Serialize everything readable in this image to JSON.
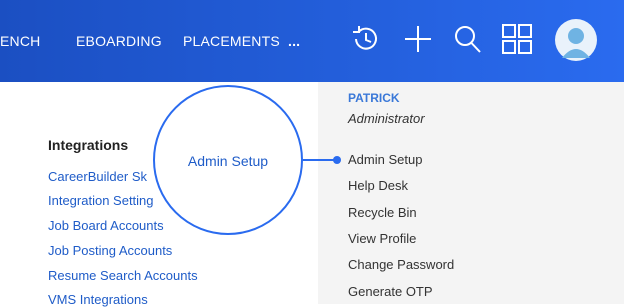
{
  "nav": {
    "items": [
      "ENCH",
      "EBOARDING",
      "PLACEMENTS",
      "..."
    ]
  },
  "icons": {
    "history": "history-icon",
    "add": "plus-icon",
    "search": "search-icon",
    "apps": "grid-icon",
    "avatar": "avatar-icon"
  },
  "left": {
    "section_title": "Integrations",
    "links": [
      "CareerBuilder Sk",
      "Integration Setting",
      "Job Board Accounts",
      "Job Posting Accounts",
      "Resume Search Accounts",
      "VMS Integrations"
    ]
  },
  "user_menu": {
    "name": "PATRICK",
    "role": "Administrator",
    "items": [
      "Admin Setup",
      "Help Desk",
      "Recycle Bin",
      "View Profile",
      "Change Password",
      "Generate OTP"
    ]
  },
  "callout": {
    "label": "Admin Setup"
  },
  "colors": {
    "accent": "#2a6bef",
    "link": "#1f5cc8",
    "menu_bg": "#f4f4f4"
  }
}
